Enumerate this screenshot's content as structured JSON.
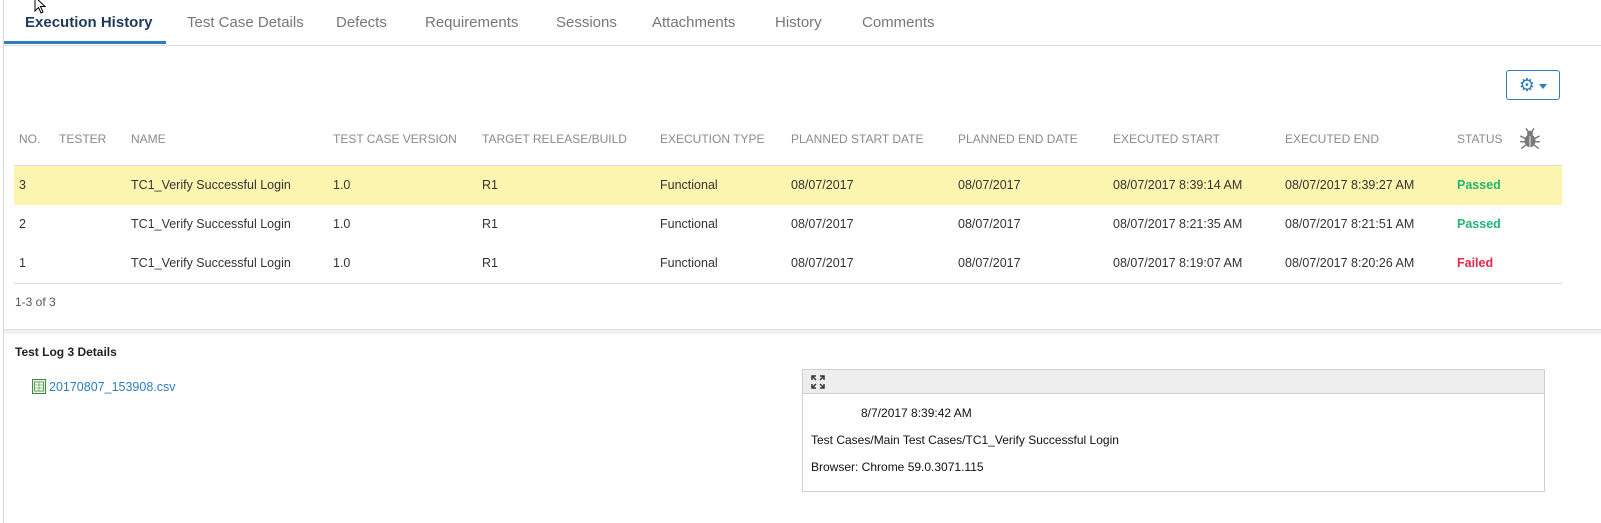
{
  "tabs": [
    {
      "label": "Execution History",
      "active": true
    },
    {
      "label": "Test Case Details"
    },
    {
      "label": "Defects"
    },
    {
      "label": "Requirements"
    },
    {
      "label": "Sessions"
    },
    {
      "label": "Attachments"
    },
    {
      "label": "History"
    },
    {
      "label": "Comments"
    }
  ],
  "table": {
    "headers": {
      "no": "NO.",
      "tester": "TESTER",
      "name": "NAME",
      "version": "TEST CASE VERSION",
      "release": "TARGET RELEASE/BUILD",
      "exec_type": "EXECUTION TYPE",
      "planned_start": "PLANNED START DATE",
      "planned_end": "PLANNED END DATE",
      "exec_start": "EXECUTED START",
      "exec_end": "EXECUTED END",
      "status": "STATUS"
    },
    "rows": [
      {
        "no": "3",
        "tester": "",
        "name": "TC1_Verify Successful Login",
        "version": "1.0",
        "release": "R1",
        "exec_type": "Functional",
        "planned_start": "08/07/2017",
        "planned_end": "08/07/2017",
        "exec_start": "08/07/2017 8:39:14 AM",
        "exec_end": "08/07/2017 8:39:27 AM",
        "status": "Passed"
      },
      {
        "no": "2",
        "tester": "",
        "name": "TC1_Verify Successful Login",
        "version": "1.0",
        "release": "R1",
        "exec_type": "Functional",
        "planned_start": "08/07/2017",
        "planned_end": "08/07/2017",
        "exec_start": "08/07/2017 8:21:35 AM",
        "exec_end": "08/07/2017 8:21:51 AM",
        "status": "Passed"
      },
      {
        "no": "1",
        "tester": "",
        "name": "TC1_Verify Successful Login",
        "version": "1.0",
        "release": "R1",
        "exec_type": "Functional",
        "planned_start": "08/07/2017",
        "planned_end": "08/07/2017",
        "exec_start": "08/07/2017 8:19:07 AM",
        "exec_end": "08/07/2017 8:20:26 AM",
        "status": "Failed"
      }
    ],
    "selected_row": 0
  },
  "pager": "1-3 of 3",
  "log": {
    "title": "Test Log 3 Details",
    "file": "20170807_153908.csv",
    "details": {
      "timestamp": "8/7/2017 8:39:42 AM",
      "path": "Test Cases/Main Test Cases/TC1_Verify Successful Login",
      "browser": "Browser: Chrome 59.0.3071.115"
    }
  },
  "colors": {
    "accent": "#2f7dbd",
    "passed": "#22b573",
    "failed": "#e8274b",
    "selected_row": "#fbf5b0"
  },
  "icons": [
    "gear-icon",
    "chevron-down-icon",
    "bug-icon",
    "spreadsheet-file-icon",
    "expand-icon",
    "mouse-cursor"
  ]
}
